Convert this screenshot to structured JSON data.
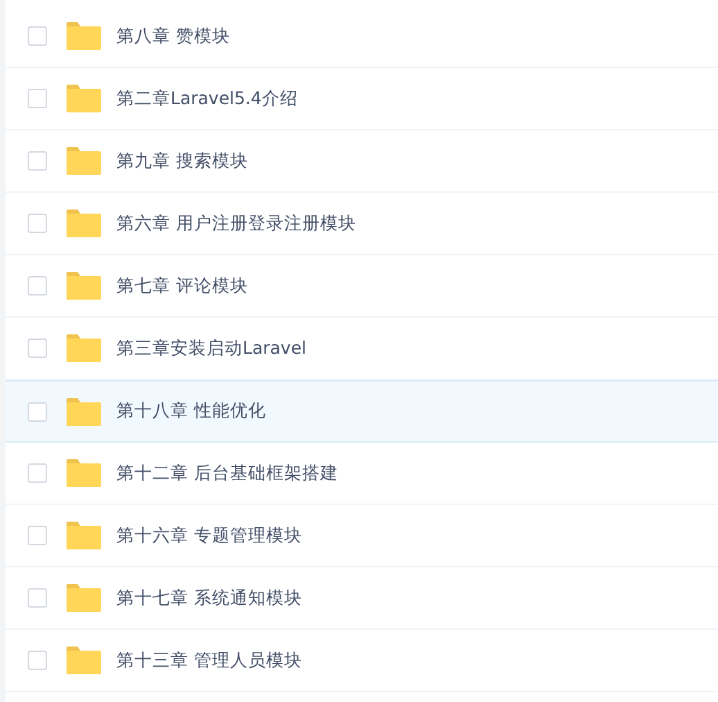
{
  "files": [
    {
      "name": "第八章 赞模块",
      "checked": false,
      "highlighted": false
    },
    {
      "name": "第二章Laravel5.4介绍",
      "checked": false,
      "highlighted": false
    },
    {
      "name": "第九章 搜索模块",
      "checked": false,
      "highlighted": false
    },
    {
      "name": "第六章 用户注册登录注册模块",
      "checked": false,
      "highlighted": false
    },
    {
      "name": "第七章 评论模块",
      "checked": false,
      "highlighted": false
    },
    {
      "name": "第三章安装启动Laravel",
      "checked": false,
      "highlighted": false
    },
    {
      "name": "第十八章 性能优化",
      "checked": false,
      "highlighted": true
    },
    {
      "name": "第十二章 后台基础框架搭建",
      "checked": false,
      "highlighted": false
    },
    {
      "name": "第十六章 专题管理模块",
      "checked": false,
      "highlighted": false
    },
    {
      "name": "第十七章 系统通知模块",
      "checked": false,
      "highlighted": false
    },
    {
      "name": "第十三章 管理人员模块",
      "checked": false,
      "highlighted": false
    }
  ]
}
